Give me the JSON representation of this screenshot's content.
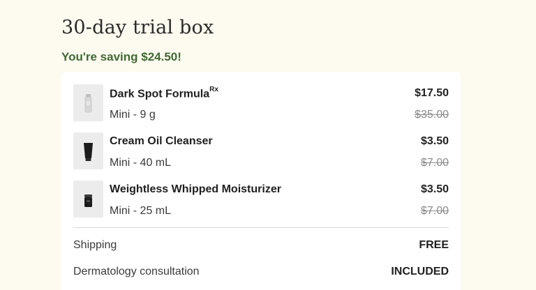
{
  "header": {
    "title": "30-day trial box",
    "savings": "You're saving $24.50!"
  },
  "items": [
    {
      "name": "Dark Spot Formula",
      "name_superscript": "Rx",
      "size": "Mini - 9 g",
      "price": "$17.50",
      "original_price": "$35.00",
      "thumb_icon": "serum-bottle-icon"
    },
    {
      "name": "Cream Oil Cleanser",
      "size": "Mini - 40 mL",
      "price": "$3.50",
      "original_price": "$7.00",
      "thumb_icon": "cleanser-tube-icon"
    },
    {
      "name": "Weightless Whipped Moisturizer",
      "size": "Mini - 25 mL",
      "price": "$3.50",
      "original_price": "$7.00",
      "thumb_icon": "moisturizer-jar-icon"
    }
  ],
  "summary": {
    "shipping_label": "Shipping",
    "shipping_value": "FREE",
    "consultation_label": "Dermatology consultation",
    "consultation_value": "INCLUDED"
  },
  "colors": {
    "background": "#fdfaef",
    "savings_green": "#3f6a34",
    "card": "#ffffff"
  }
}
